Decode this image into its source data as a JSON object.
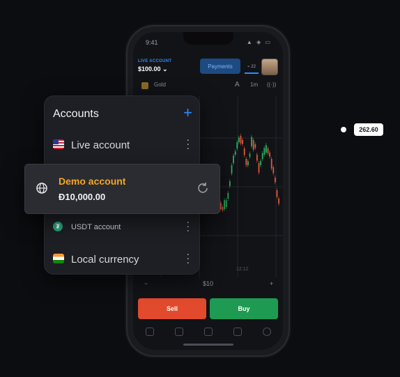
{
  "status": {
    "time": "9:41",
    "icons": "▲ ◈ ▭"
  },
  "header": {
    "account_label": "LIVE ACCOUNT",
    "balance": "$100.00 ⌄",
    "payments_label": "Payments",
    "badge": "⌁ 22"
  },
  "asset": {
    "name": "Gold",
    "timeframe": "1m",
    "tool_icon": "A",
    "signal_icon": "((·))"
  },
  "chart_price": "262.60",
  "chart_time_label": "12:12",
  "trade": {
    "minus": "−",
    "amount": "$10",
    "plus": "+",
    "sell_label": "Sell",
    "buy_label": "Buy"
  },
  "accounts": {
    "title": "Accounts",
    "add_icon": "+",
    "items": [
      {
        "label": "Live account",
        "flag": "us-flag-icon"
      },
      {
        "label": "USDT account",
        "flag": "usdt-icon"
      },
      {
        "label": "Local currency",
        "flag": "india-flag-icon"
      }
    ],
    "demo": {
      "name": "Demo account",
      "balance": "Đ10,000.00"
    }
  },
  "colors": {
    "accent": "#2f8cff",
    "demo": "#f5a623",
    "sell": "#e24a2d",
    "buy": "#1e9a52"
  }
}
